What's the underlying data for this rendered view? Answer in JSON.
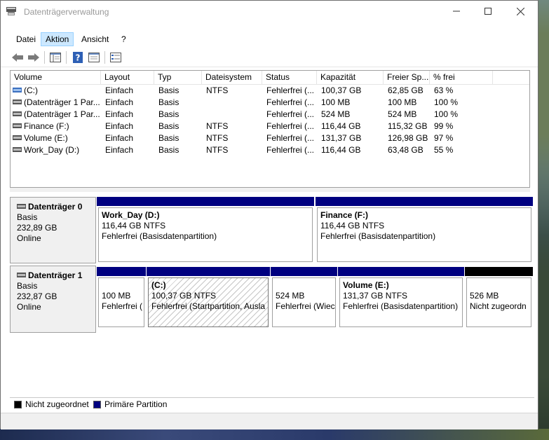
{
  "window": {
    "title": "Datenträgerverwaltung"
  },
  "menu": [
    "Datei",
    "Aktion",
    "Ansicht",
    "?"
  ],
  "table": {
    "columns": [
      "Volume",
      "Layout",
      "Typ",
      "Dateisystem",
      "Status",
      "Kapazität",
      "Freier Sp...",
      "% frei"
    ],
    "rows": [
      [
        "(C:)",
        "Einfach",
        "Basis",
        "NTFS",
        "Fehlerfrei (...",
        "100,37 GB",
        "62,85 GB",
        "63 %"
      ],
      [
        "(Datenträger 1 Par...",
        "Einfach",
        "Basis",
        "",
        "Fehlerfrei (...",
        "100 MB",
        "100 MB",
        "100 %"
      ],
      [
        "(Datenträger 1 Par...",
        "Einfach",
        "Basis",
        "",
        "Fehlerfrei (...",
        "524 MB",
        "524 MB",
        "100 %"
      ],
      [
        "Finance (F:)",
        "Einfach",
        "Basis",
        "NTFS",
        "Fehlerfrei (...",
        "116,44 GB",
        "115,32 GB",
        "99 %"
      ],
      [
        "Volume (E:)",
        "Einfach",
        "Basis",
        "NTFS",
        "Fehlerfrei (...",
        "131,37 GB",
        "126,98 GB",
        "97 %"
      ],
      [
        "Work_Day (D:)",
        "Einfach",
        "Basis",
        "NTFS",
        "Fehlerfrei (...",
        "116,44 GB",
        "63,48 GB",
        "55 %"
      ]
    ]
  },
  "disks": [
    {
      "name": "Datenträger 0",
      "type": "Basis",
      "size": "232,89 GB",
      "status": "Online",
      "partitions": [
        {
          "title": "Work_Day  (D:)",
          "size": "116,44 GB NTFS",
          "status": "Fehlerfrei (Basisdatenpartition)"
        },
        {
          "title": "Finance  (F:)",
          "size": "116,44 GB NTFS",
          "status": "Fehlerfrei (Basisdatenpartition)"
        }
      ]
    },
    {
      "name": "Datenträger 1",
      "type": "Basis",
      "size": "232,87 GB",
      "status": "Online",
      "partitions": [
        {
          "title": "",
          "size": "100 MB",
          "status": "Fehlerfrei ("
        },
        {
          "title": "(C:)",
          "size": "100,37 GB NTFS",
          "status": "Fehlerfrei (Startpartition, Ausla"
        },
        {
          "title": "",
          "size": "524 MB",
          "status": "Fehlerfrei (Wiec"
        },
        {
          "title": "Volume  (E:)",
          "size": "131,37 GB NTFS",
          "status": "Fehlerfrei (Basisdatenpartition)"
        },
        {
          "title": "",
          "size": "526 MB",
          "status": "Nicht zugeordn"
        }
      ]
    }
  ],
  "legend": [
    {
      "label": "Nicht zugeordnet",
      "color": "#000000"
    },
    {
      "label": "Primäre Partition",
      "color": "#000080"
    }
  ],
  "colors": {
    "primary": "#000080",
    "unallocated": "#000000",
    "menu_highlight": "#cce8ff"
  },
  "icons": [
    "disk-management-icon",
    "back-arrow-icon",
    "forward-arrow-icon",
    "console-tree-icon",
    "help-icon",
    "properties-icon",
    "list-view-icon"
  ]
}
